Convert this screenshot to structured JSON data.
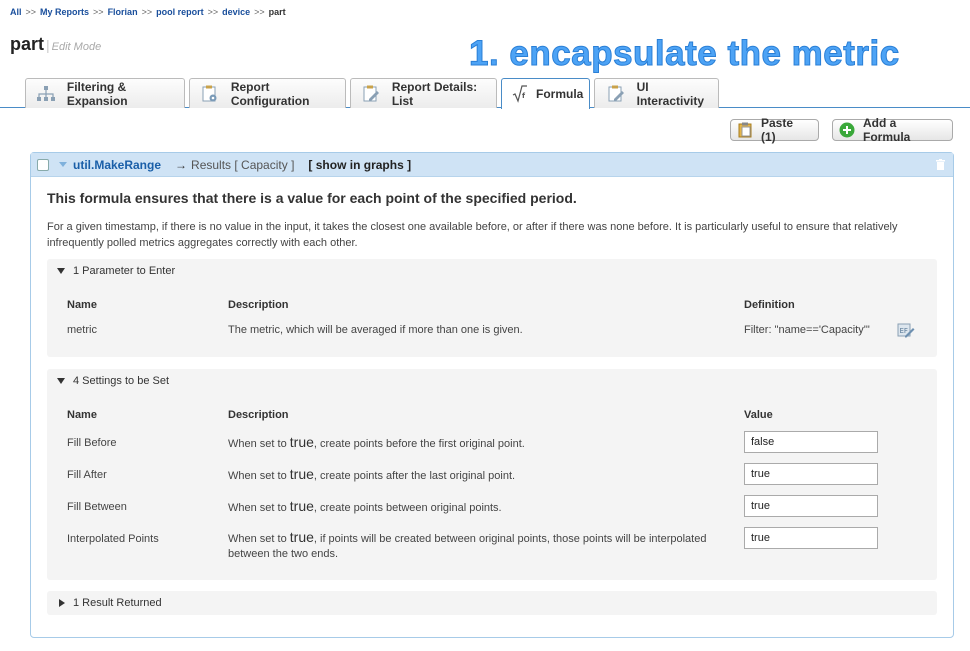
{
  "breadcrumb": {
    "items": [
      "All",
      "My Reports",
      "Florian",
      "pool report",
      "device"
    ],
    "current": "part",
    "separator": ">>"
  },
  "page": {
    "title": "part",
    "mode": "Edit Mode"
  },
  "annotation": "1. encapsulate the metric",
  "tabs": [
    {
      "label": "Filtering & Expansion",
      "icon": "hierarchy-icon"
    },
    {
      "label": "Report Configuration",
      "icon": "config-icon"
    },
    {
      "label": "Report Details: List",
      "icon": "edit-doc-icon"
    },
    {
      "label": "Formula",
      "icon": "sqrt-icon",
      "active": true
    },
    {
      "label": "UI Interactivity",
      "icon": "edit-doc-icon"
    }
  ],
  "toolbar": {
    "paste_label": "Paste (1)",
    "add_formula_label": "Add a Formula"
  },
  "formula": {
    "name": "util.MakeRange",
    "arrow": "→",
    "results": "Results [ Capacity ]",
    "show_in_graphs": "[ show in graphs ]",
    "title": "This formula ensures that there is a value for each point of the specified period.",
    "description": "For a given timestamp, if there is no value in the input, it takes the closest one available before, or after if there was none before. It is particularly useful to ensure that relatively infrequently polled metrics aggregates correctly with each other."
  },
  "parameters": {
    "header": "1 Parameter to Enter",
    "col_name": "Name",
    "col_description": "Description",
    "col_definition": "Definition",
    "rows": [
      {
        "name": "metric",
        "description": "The metric, which will be averaged if more than one is given.",
        "definition": "Filter: \"name=='Capacity'\""
      }
    ]
  },
  "settings": {
    "header": "4 Settings to be Set",
    "col_name": "Name",
    "col_description": "Description",
    "col_value": "Value",
    "rows": [
      {
        "name": "Fill Before",
        "pre": "When set to",
        "kw": "true",
        "post": ", create points before the first original point.",
        "value": "false"
      },
      {
        "name": "Fill After",
        "pre": "When set to",
        "kw": "true",
        "post": ", create points after the last original point.",
        "value": "true"
      },
      {
        "name": "Fill Between",
        "pre": "When set to",
        "kw": "true",
        "post": ", create points between original points.",
        "value": "true"
      },
      {
        "name": "Interpolated Points",
        "pre": "When set to",
        "kw": "true",
        "post": ", if points will be created between original points, those points will be interpolated between the two ends.",
        "value": "true"
      }
    ]
  },
  "results_section": {
    "header": "1 Result Returned"
  }
}
